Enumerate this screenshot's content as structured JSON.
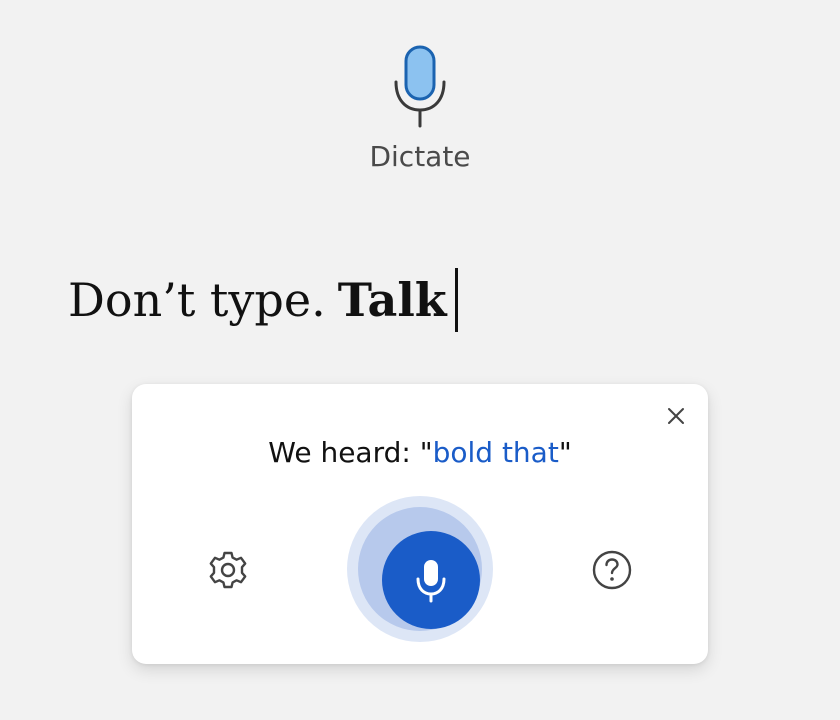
{
  "header": {
    "icon": "microphone-icon",
    "label": "Dictate"
  },
  "document": {
    "text_regular": "Don’t type.",
    "text_bold": "Talk"
  },
  "panel": {
    "heard_prefix": "We heard: \"",
    "heard_phrase": "bold that",
    "heard_suffix": "\"",
    "close_icon": "close-icon",
    "settings_icon": "gear-icon",
    "mic_icon": "microphone-icon",
    "help_icon": "help-circle-icon"
  },
  "colors": {
    "accent": "#1a5cc8",
    "background": "#f2f2f2",
    "mic_header_fill": "#8cc2f0",
    "mic_header_stroke": "#1b63b0"
  }
}
